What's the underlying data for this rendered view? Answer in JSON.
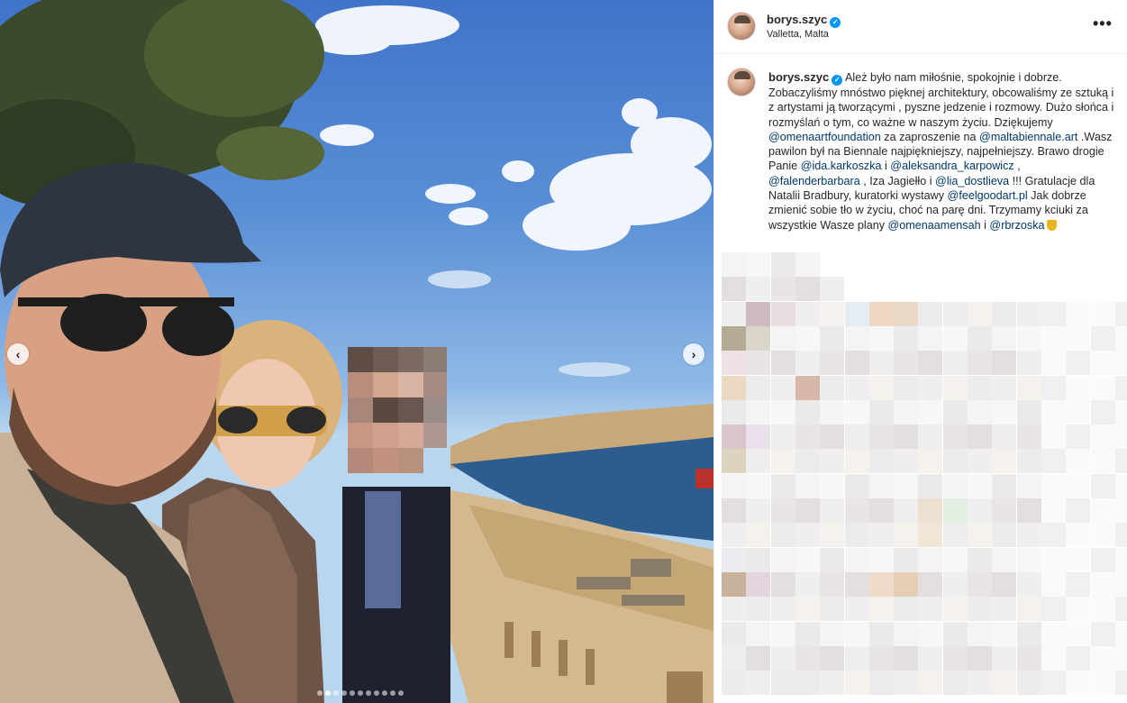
{
  "post": {
    "username": "borys.szyc",
    "verified_badge": "verified-badge-icon",
    "location": "Valletta, Malta",
    "more_label": "•••"
  },
  "caption": {
    "username": "borys.szyc",
    "segments": [
      {
        "type": "text",
        "text": " Ależ było nam miłośnie, spokojnie i dobrze. Zobaczyliśmy mnóstwo pięknej architektury, obcowaliśmy ze sztuką i z artystami ją tworzącymi , pyszne jedzenie i rozmowy. Dużo słońca i rozmyślań o tym, co ważne w naszym życiu. Dziękujemy "
      },
      {
        "type": "mention",
        "text": "@omenaartfoundation"
      },
      {
        "type": "text",
        "text": " za zaproszenie na "
      },
      {
        "type": "mention",
        "text": "@maltabiennale.art"
      },
      {
        "type": "text",
        "text": " .Wasz pawilon był na Biennale najpiękniejszy, najpełniejszy. Brawo drogie Panie "
      },
      {
        "type": "mention",
        "text": "@ida.karkoszka"
      },
      {
        "type": "text",
        "text": " i "
      },
      {
        "type": "mention",
        "text": "@aleksandra_karpowicz"
      },
      {
        "type": "text",
        "text": " , "
      },
      {
        "type": "mention",
        "text": "@falenderbarbara"
      },
      {
        "type": "text",
        "text": " , Iza Jagiełło i "
      },
      {
        "type": "mention",
        "text": "@lia_dostlieva"
      },
      {
        "type": "text",
        "text": " !!! Gratulacje dla Natalii Bradbury, kuratorki wystawy "
      },
      {
        "type": "mention",
        "text": "@feelgoodart.pl"
      },
      {
        "type": "text",
        "text": " Jak dobrze zmienić sobie tło w życiu, choć na parę dni. Trzymamy kciuki za wszystkie Wasze plany "
      },
      {
        "type": "mention",
        "text": "@omenaamensah"
      },
      {
        "type": "text",
        "text": " i "
      },
      {
        "type": "mention",
        "text": "@rbrzoska"
      },
      {
        "type": "emoji",
        "text": "shield-emoji"
      }
    ]
  },
  "carousel": {
    "prev_icon": "chevron-left-icon",
    "next_icon": "chevron-right-icon",
    "prev_glyph": "‹",
    "next_glyph": "›",
    "total_slides": 11,
    "active_index": 1
  },
  "colors": {
    "mention": "#00376b",
    "verified": "#0095f6",
    "text": "#262626"
  }
}
